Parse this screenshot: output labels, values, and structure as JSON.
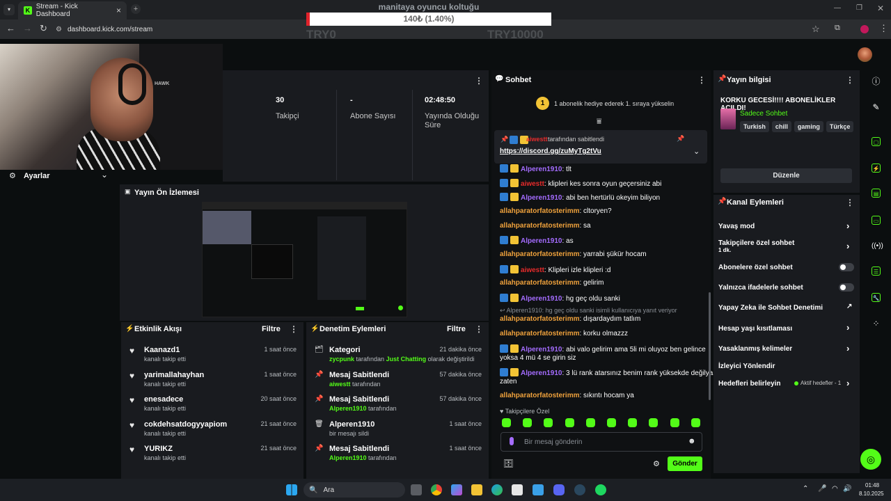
{
  "browser": {
    "tab_title": "Stream - Kick Dashboard",
    "url": "dashboard.kick.com/stream"
  },
  "overlay": {
    "title": "manitaya oyuncu koltuğu",
    "current": "140₺ (1.40%)",
    "progress_percent": 1.4,
    "min_label": "TRY0",
    "max_label": "TRY10000",
    "fill_color": "#e1222b"
  },
  "stats": {
    "followers_value": "30",
    "followers_label": "Takipçi",
    "subs_value": "-",
    "subs_label": "Abone Sayısı",
    "time_value": "02:48:50",
    "time_label": "Yayında Olduğu Süre"
  },
  "webcam": {
    "chair_text": "HAWK"
  },
  "settings": {
    "label": "Ayarlar"
  },
  "preview": {
    "title": "Yayın Ön İzlemesi"
  },
  "activity": {
    "title": "Etkinlik Akışı",
    "filter": "Filtre",
    "items": [
      {
        "name": "Kaanazd1",
        "desc": "kanalı takip etti",
        "time": "1 saat önce"
      },
      {
        "name": "yarimallahayhan",
        "desc": "kanalı takip etti",
        "time": "1 saat önce"
      },
      {
        "name": "enesadece",
        "desc": "kanalı takip etti",
        "time": "20 saat önce"
      },
      {
        "name": "cokdehsatdogyyapiom",
        "desc": "kanalı takip etti",
        "time": "21 saat önce"
      },
      {
        "name": "YURIKZ",
        "desc": "kanalı takip etti",
        "time": "21 saat önce"
      }
    ]
  },
  "moderation": {
    "title": "Denetim Eylemleri",
    "filter": "Filtre",
    "items": [
      {
        "name": "Kategori",
        "user": "zycpunk",
        "mid": "tarafından",
        "extra": "Just Chatting",
        "tail": "olarak değiştirildi",
        "time": "21 dakika önce"
      },
      {
        "name": "Mesaj Sabitlendi",
        "user": "aiwestt",
        "mid": "tarafından",
        "time": "57 dakika önce"
      },
      {
        "name": "Mesaj Sabitlendi",
        "user": "Alperen1910",
        "mid": "tarafından",
        "time": "57 dakika önce"
      },
      {
        "name": "Alperen1910",
        "desc": "bir mesajı sildi",
        "time": "1 saat önce"
      },
      {
        "name": "Mesaj Sabitlendi",
        "user": "Alperen1910",
        "mid": "tarafından",
        "time": "1 saat önce"
      }
    ]
  },
  "chat": {
    "title": "Sohbet",
    "gift_banner": "1 abonelik hediye ederek 1. sıraya yükselin",
    "gift_rank": "1",
    "pinned_by_user": "aiwestt",
    "pinned_by_text": "tarafından sabitlendi",
    "pinned_link": "https://discord.gg/zuMyTg2tVu",
    "messages": [
      {
        "user": "Alperen1910",
        "text": ": tlt",
        "color": "u1",
        "badges": true
      },
      {
        "user": "aiwestt",
        "text": ": klipleri kes sonra oyun geçersiniz abi",
        "color": "u2",
        "badges": true
      },
      {
        "user": "Alperen1910",
        "text": ": abi ben hertürlü okeyim biliyon",
        "color": "u1",
        "badges": true
      },
      {
        "user": "allahparatorfatosterimm",
        "text": ": cltoryen?",
        "color": "u3",
        "badges": false
      },
      {
        "user": "allahparatorfatosterimm",
        "text": ": sa",
        "color": "u3",
        "badges": false
      },
      {
        "user": "Alperen1910",
        "text": ": as",
        "color": "u1",
        "badges": true
      },
      {
        "user": "allahparatorfatosterimm",
        "text": ": yarrabi şükür hocam",
        "color": "u3",
        "badges": false
      },
      {
        "user": "aiwestt",
        "text": ": Klipleri izle klipleri :d",
        "color": "u2",
        "badges": true
      },
      {
        "user": "allahparatorfatosterimm",
        "text": ": gelirim",
        "color": "u3",
        "badges": false
      },
      {
        "user": "Alperen1910",
        "text": ": hg geç oldu sanki",
        "color": "u1",
        "badges": true
      }
    ],
    "reply_note": "Alperen1910: hg geç oldu sanki isimli kullanıcıya yanıt veriyor",
    "messages2": [
      {
        "user": "allahparatorfatosterimm",
        "text": ": dışardaydım tatlım",
        "color": "u3"
      },
      {
        "user": "allahparatorfatosterimm",
        "text": ": korku olmazzz",
        "color": "u3"
      }
    ],
    "long_msg1_user": "Alperen1910",
    "long_msg1_a": ": abi valo gelirim ama 5li mi oluyoz ben gelince",
    "long_msg1_b": "yoksa 4 mü 4 se girin siz",
    "long_msg2_user": "Alperen1910",
    "long_msg2_a": ": 3 lü rank atarsınız benim rank yüksekde değilya",
    "long_msg2_b": "zaten",
    "last_user": "allahparatorfatosterimm",
    "last_text": ": sıkıntı hocam ya",
    "mode_label": "Takipçilere Özel",
    "input_placeholder": "Bir mesaj gönderin",
    "send_label": "Gönder"
  },
  "stream_info": {
    "title": "Yayın bilgisi",
    "stream_title": "KORKU GECESİ!!!! ABONELİKLER AÇILDI!",
    "category": "Sadece Sohbet",
    "tags": [
      "Turkish",
      "chill",
      "gaming",
      "Türkçe"
    ],
    "edit_label": "Düzenle"
  },
  "channel_actions": {
    "title": "Kanal Eylemleri",
    "slow_mode": "Yavaş mod",
    "followers_only": "Takipçilere özel sohbet",
    "followers_only_value": "1 dk.",
    "subs_only": "Abonelere özel sohbet",
    "emotes_only": "Yalnızca ifadelerle sohbet",
    "ai_mod": "Yapay Zeka ile Sohbet Denetimi",
    "age_limits": "Hesap yaşı kısıtlaması",
    "banned_words": "Yasaklanmış kelimeler",
    "raid": "İzleyici Yönlendir",
    "goals": "Hedefleri belirleyin",
    "goals_status": "Aktif hedefler - 1"
  },
  "taskbar": {
    "search": "Ara",
    "time": "01:48",
    "date": "8.10.2025"
  }
}
